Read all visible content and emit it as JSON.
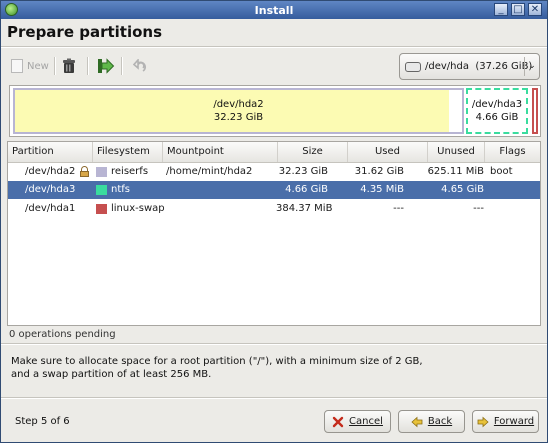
{
  "window": {
    "title": "Install",
    "controls": {
      "minimize": "_",
      "maximize": "□",
      "close": "✕"
    }
  },
  "page": {
    "heading": "Prepare partitions"
  },
  "toolbar": {
    "new_label": "New",
    "icons": [
      "new-document-icon",
      "delete-icon",
      "apply-arrow-icon",
      "undo-icon"
    ]
  },
  "disk_selector": {
    "value": "/dev/hda  (37.26 GiB)",
    "icon": "harddisk-icon"
  },
  "partition_map": [
    {
      "name": "/dev/hda2",
      "size": "32.23 GiB",
      "color": "#fcf9a9",
      "border_color": "#b8b5d3",
      "used_fraction": 0.98
    },
    {
      "name": "/dev/hda3",
      "size": "4.66 GiB",
      "color": "#ffffff",
      "border_color": "#3adc9e",
      "used_fraction": 1.0
    },
    {
      "name": "",
      "size": "",
      "color": "#ffffff",
      "border_color": "#c64f4f",
      "used_fraction": 0
    }
  ],
  "table": {
    "columns": [
      "Partition",
      "Filesystem",
      "Mountpoint",
      "Size",
      "Used",
      "Unused",
      "Flags"
    ],
    "rows": [
      {
        "partition": "/dev/hda2",
        "locked": true,
        "filesystem": "reiserfs",
        "fs_color": "#b8b5d3",
        "mountpoint": "/home/mint/hda2",
        "size": "32.23 GiB",
        "used": "31.62 GiB",
        "unused": "625.11 MiB",
        "flags": "boot",
        "selected": false
      },
      {
        "partition": "/dev/hda3",
        "locked": false,
        "filesystem": "ntfs",
        "fs_color": "#3adc9e",
        "mountpoint": "",
        "size": "4.66 GiB",
        "used": "4.35 MiB",
        "unused": "4.65 GiB",
        "flags": "",
        "selected": true
      },
      {
        "partition": "/dev/hda1",
        "locked": false,
        "filesystem": "linux-swap",
        "fs_color": "#c64f4f",
        "mountpoint": "",
        "size": "384.37 MiB",
        "used": "---",
        "unused": "---",
        "flags": "",
        "selected": false
      }
    ]
  },
  "status": {
    "operations": "0 operations pending"
  },
  "note": "Make sure to allocate space for a root partition (\"/\"), with a minimum size of 2 GB, and a swap partition of at least 256 MB.",
  "footer": {
    "step": "Step 5 of 6",
    "cancel_label": "Cancel",
    "back_label": "Back",
    "forward_label": "Forward"
  },
  "colors": {
    "selection": "#4a6ea9",
    "titlebar": "#355c9d"
  }
}
